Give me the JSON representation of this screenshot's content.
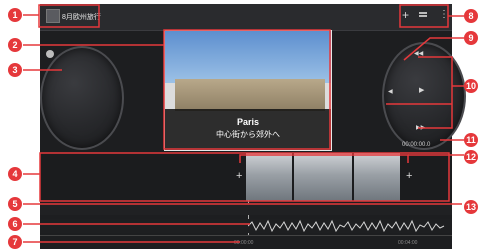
{
  "project": {
    "title": "8月欧州旅行"
  },
  "toolbar": {
    "add_icon": "add-media-icon",
    "overflow_icon": "overflow-menu-icon",
    "mid_icon": "equalizer-icon"
  },
  "preview": {
    "city": "Paris",
    "subtitle": "中心街から郊外へ"
  },
  "playback": {
    "timecode": "00:00:00.0",
    "rewind_icon": "rewind-icon",
    "play_icon": "play-icon",
    "ff_icon": "fast-forward-icon",
    "prev_icon": "previous-icon"
  },
  "timeline": {
    "start_label": "00:00:00",
    "end_label": "00:04:00"
  },
  "callouts": [
    "1",
    "2",
    "3",
    "4",
    "5",
    "6",
    "7",
    "8",
    "9",
    "10",
    "11",
    "12",
    "13"
  ],
  "colors": {
    "accent": "#e5383b",
    "app_bg": "#1d1e20",
    "toolbar_bg": "#2a2b2e"
  }
}
